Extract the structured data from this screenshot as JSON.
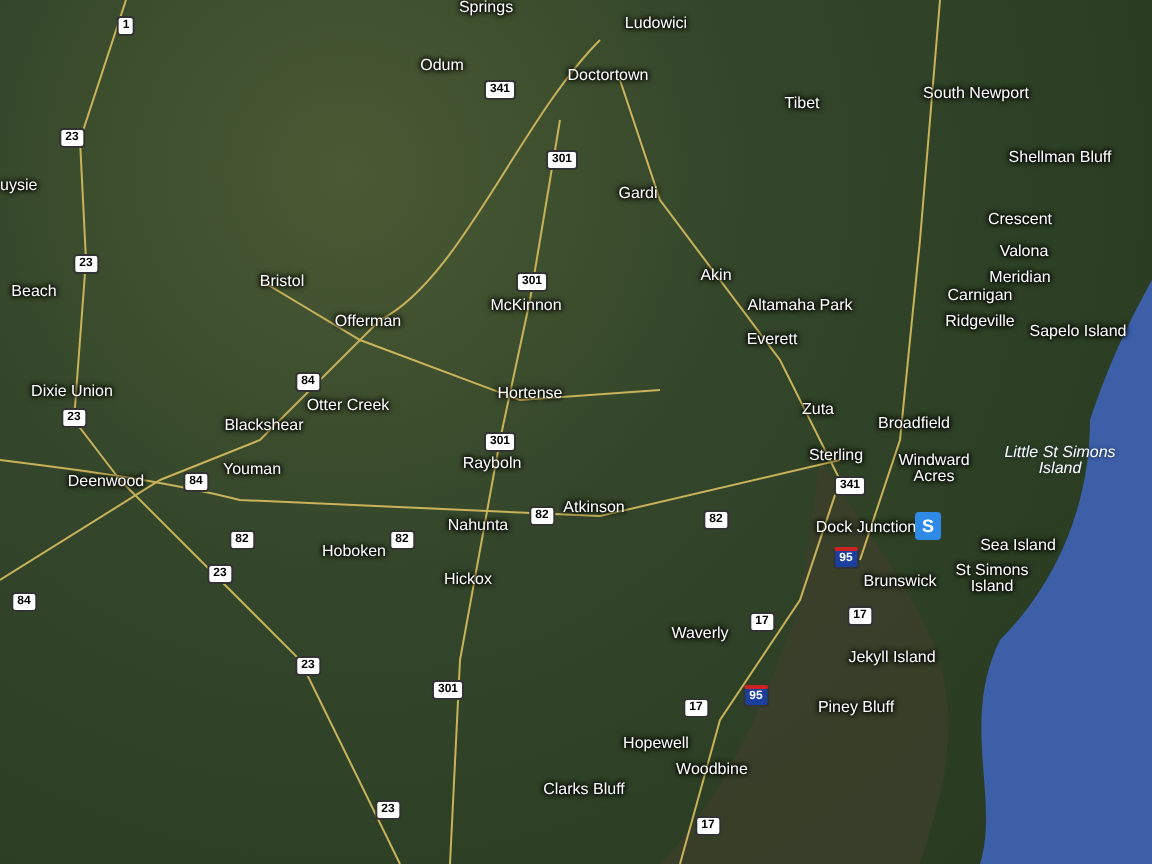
{
  "map": {
    "places": [
      "Springs",
      "Ludowici",
      "Odum",
      "Doctortown",
      "Tibet",
      "South Newport",
      "Shellman Bluff",
      "Gardi",
      "Crescent",
      "uysie",
      "Valona",
      "Akin",
      "Meridian",
      "Carnigan",
      "Altamaha Park",
      "Beach",
      "Bristol",
      "McKinnon",
      "Ridgeville",
      "Offerman",
      "Sapelo Island",
      "Everett",
      "Dixie Union",
      "Hortense",
      "Otter Creek",
      "Zuta",
      "Broadfield",
      "Blackshear",
      "Deenwood",
      "Youman",
      "Rayboln",
      "Sterling",
      "Windward Acres",
      "Atkinson",
      "Nahunta",
      "Dock Junction",
      "Hoboken",
      "Sea Island",
      "Hickox",
      "Brunswick",
      "St Simons Island",
      "Waverly",
      "Jekyll Island",
      "Piney Bluff",
      "Hopewell",
      "Woodbine",
      "Clarks Bluff"
    ],
    "water_label": "Little St Simons Island",
    "route_shields": [
      {
        "kind": "us",
        "number": "1"
      },
      {
        "kind": "us",
        "number": "23"
      },
      {
        "kind": "us",
        "number": "341"
      },
      {
        "kind": "us",
        "number": "301"
      },
      {
        "kind": "us",
        "number": "23"
      },
      {
        "kind": "us",
        "number": "301"
      },
      {
        "kind": "us",
        "number": "84"
      },
      {
        "kind": "us",
        "number": "23"
      },
      {
        "kind": "us",
        "number": "301"
      },
      {
        "kind": "us",
        "number": "84"
      },
      {
        "kind": "us",
        "number": "82"
      },
      {
        "kind": "us",
        "number": "82"
      },
      {
        "kind": "us",
        "number": "82"
      },
      {
        "kind": "us",
        "number": "23"
      },
      {
        "kind": "us",
        "number": "84"
      },
      {
        "kind": "us",
        "number": "23"
      },
      {
        "kind": "us",
        "number": "301"
      },
      {
        "kind": "us",
        "number": "23"
      },
      {
        "kind": "us",
        "number": "341"
      },
      {
        "kind": "us",
        "number": "82"
      },
      {
        "kind": "interstate",
        "number": "95"
      },
      {
        "kind": "us",
        "number": "17"
      },
      {
        "kind": "us",
        "number": "17"
      },
      {
        "kind": "interstate",
        "number": "95"
      },
      {
        "kind": "us",
        "number": "17"
      },
      {
        "kind": "us",
        "number": "17"
      }
    ],
    "marker": {
      "label": "S"
    }
  }
}
